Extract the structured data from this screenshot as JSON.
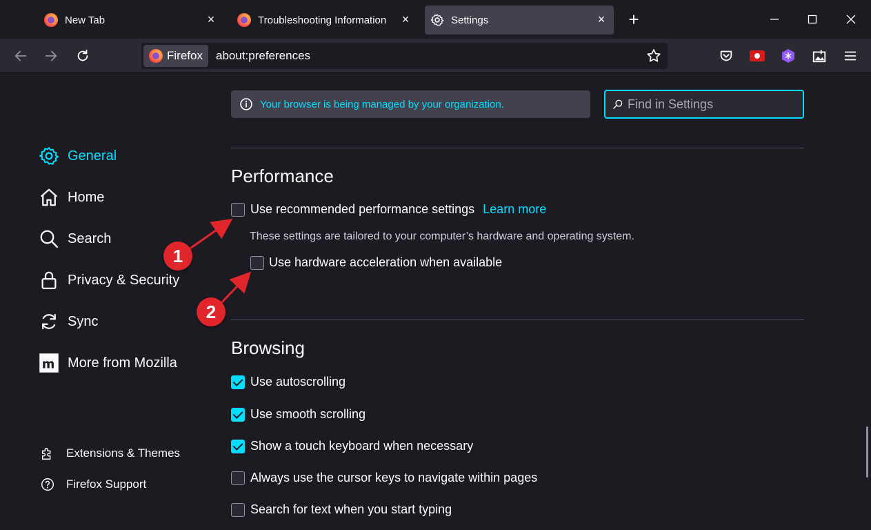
{
  "tabs": [
    {
      "title": "New Tab",
      "active": false
    },
    {
      "title": "Troubleshooting Information",
      "active": false
    },
    {
      "title": "Settings",
      "active": true
    }
  ],
  "icons": {
    "new_tab": "plus-icon",
    "minimize": "minimize-icon",
    "maximize": "maximize-icon",
    "close": "close-icon",
    "back": "arrow-left-icon",
    "forward": "arrow-right-icon",
    "reload": "reload-icon",
    "bookmark": "star-icon",
    "pocket": "pocket-icon",
    "menu": "hamburger-icon"
  },
  "urlbar": {
    "identity_label": "Firefox",
    "url": "about:preferences"
  },
  "managed_notice": "Your browser is being managed by your organization.",
  "search": {
    "placeholder": "Find in Settings"
  },
  "sidebar": {
    "items": [
      {
        "label": "General",
        "icon": "gear-icon",
        "selected": true
      },
      {
        "label": "Home",
        "icon": "home-icon"
      },
      {
        "label": "Search",
        "icon": "search-icon"
      },
      {
        "label": "Privacy & Security",
        "icon": "lock-icon"
      },
      {
        "label": "Sync",
        "icon": "sync-icon"
      },
      {
        "label": "More from Mozilla",
        "icon": "mozilla-icon"
      }
    ],
    "footer": [
      {
        "label": "Extensions & Themes",
        "icon": "puzzle-icon"
      },
      {
        "label": "Firefox Support",
        "icon": "help-icon"
      }
    ]
  },
  "performance": {
    "heading": "Performance",
    "recommended": {
      "label": "Use recommended performance settings",
      "checked": false,
      "link": "Learn more"
    },
    "description": "These settings are tailored to your computer’s hardware and operating system.",
    "hw_accel": {
      "label": "Use hardware acceleration when available",
      "checked": false
    }
  },
  "browsing": {
    "heading": "Browsing",
    "options": [
      {
        "label": "Use autoscrolling",
        "checked": true
      },
      {
        "label": "Use smooth scrolling",
        "checked": true
      },
      {
        "label": "Show a touch keyboard when necessary",
        "checked": true
      },
      {
        "label": "Always use the cursor keys to navigate within pages",
        "checked": false
      },
      {
        "label": "Search for text when you start typing",
        "checked": false
      }
    ]
  },
  "annotations": {
    "badge1": "1",
    "badge2": "2",
    "color": "#e0262b"
  },
  "accent": "#00ddff"
}
